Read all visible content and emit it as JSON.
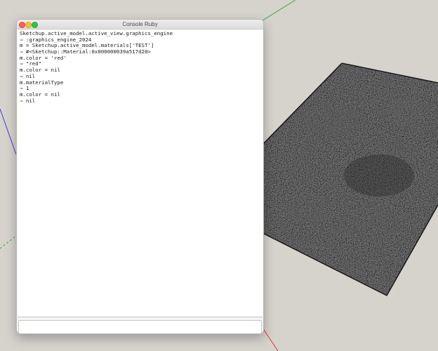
{
  "window": {
    "title": "Console Ruby"
  },
  "console": {
    "lines": [
      "Sketchup.active_model.active_view.graphics_engine",
      "⇒ :graphics_engine_2024",
      "m = Sketchup.active_model.materials['TEST']",
      "⇒ #<Sketchup::Material:0x000000039a517d20>",
      "m.color = 'red'",
      "⇒ \"red\"",
      "m.color = nil",
      "⇒ nil",
      "m.materialType",
      "⇒ 1",
      "m.color = nil",
      "⇒ nil"
    ],
    "input_value": ""
  },
  "colors": {
    "background": "#d6d3cd",
    "axis_green": "#3faa3f",
    "axis_red": "#d23c3c",
    "axis_blue": "#3c3cd2",
    "texture_base": "#2d2d2d"
  }
}
